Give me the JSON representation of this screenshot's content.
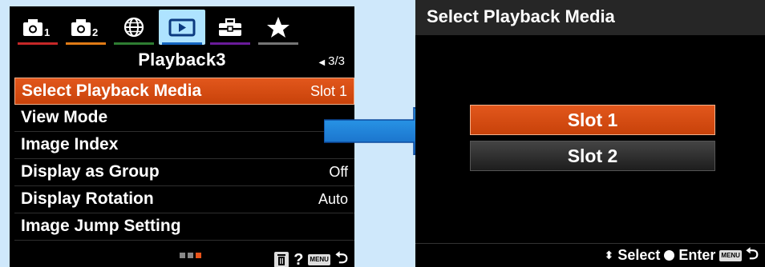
{
  "top_fragment": "",
  "left_screen": {
    "tabs": [
      {
        "name": "camera-1-tab",
        "label": "1",
        "underline": "#c62828",
        "icon": "camera-icon"
      },
      {
        "name": "camera-2-tab",
        "label": "2",
        "underline": "#e07b16",
        "icon": "camera-icon"
      },
      {
        "name": "network-tab",
        "label": "",
        "underline": "#2e7d32",
        "icon": "globe-icon"
      },
      {
        "name": "playback-tab",
        "label": "",
        "underline": "#1565c0",
        "icon": "playback-icon",
        "active": true
      },
      {
        "name": "setup-tab",
        "label": "",
        "underline": "#6a1b9a",
        "icon": "toolbox-icon"
      },
      {
        "name": "my-menu-tab",
        "label": "",
        "underline": "#757575",
        "icon": "star-icon"
      }
    ],
    "page_title": "Playback3",
    "page_indicator": "3/3",
    "menu_items": [
      {
        "label": "Select Playback Media",
        "value": "Slot 1",
        "selected": true
      },
      {
        "label": "View Mode",
        "value": ""
      },
      {
        "label": "Image Index",
        "value": ""
      },
      {
        "label": "Display as Group",
        "value": "Off"
      },
      {
        "label": "Display Rotation",
        "value": "Auto"
      },
      {
        "label": "Image Jump Setting",
        "value": ""
      }
    ],
    "footer": {
      "help": "?",
      "menu_badge": "MENU",
      "back": "⮌"
    }
  },
  "right_screen": {
    "title": "Select Playback Media",
    "options": [
      "Slot 1",
      "Slot 2"
    ],
    "footer": {
      "select_label": "Select",
      "enter_label": "Enter",
      "menu_badge": "MENU",
      "updown": "⬍",
      "back": "⮌"
    }
  },
  "colors": {
    "accent": "#e2571c",
    "arrow": "#1e88e5"
  }
}
